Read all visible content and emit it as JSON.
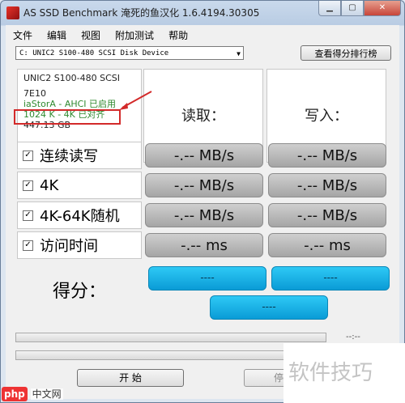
{
  "window": {
    "title": "AS SSD Benchmark 淹死的鱼汉化 1.6.4194.30305"
  },
  "menu": [
    "文件",
    "编辑",
    "视图",
    "附加测试",
    "帮助"
  ],
  "drive": {
    "selected": "C: UNIC2 S100-480 SCSI Disk Device"
  },
  "ranking_button": "查看得分排行榜",
  "info": {
    "model": "UNIC2 S100-480 SCSI",
    "firmware": "7E10",
    "driver": "iaStorA - AHCI 已启用",
    "alignment": "1024 K - 4K 已对齐",
    "size": "447.13 GB"
  },
  "headers": {
    "read": "读取：",
    "write": "写入："
  },
  "rows": [
    {
      "label": "连续读写",
      "checked": true,
      "read": "-.-- MB/s",
      "write": "-.-- MB/s"
    },
    {
      "label": "4K",
      "checked": true,
      "read": "-.-- MB/s",
      "write": "-.-- MB/s"
    },
    {
      "label": "4K-64K随机",
      "checked": true,
      "read": "-.-- MB/s",
      "write": "-.-- MB/s"
    },
    {
      "label": "访问时间",
      "checked": true,
      "read": "-.-- ms",
      "write": "-.-- ms"
    }
  ],
  "score": {
    "label": "得分：",
    "read": "----",
    "write": "----",
    "total": "----"
  },
  "timer": "--:--",
  "buttons": {
    "start": "开 始",
    "abort": "停"
  },
  "watermark": {
    "text": "软件技巧",
    "logo_php": "php",
    "logo_cn": "中文网"
  },
  "colors": {
    "score_blue": "#0a9bd6",
    "result_gray": "#a5a5a5",
    "highlight_red": "#d32a2a",
    "ok_green": "#2f8a2f"
  }
}
